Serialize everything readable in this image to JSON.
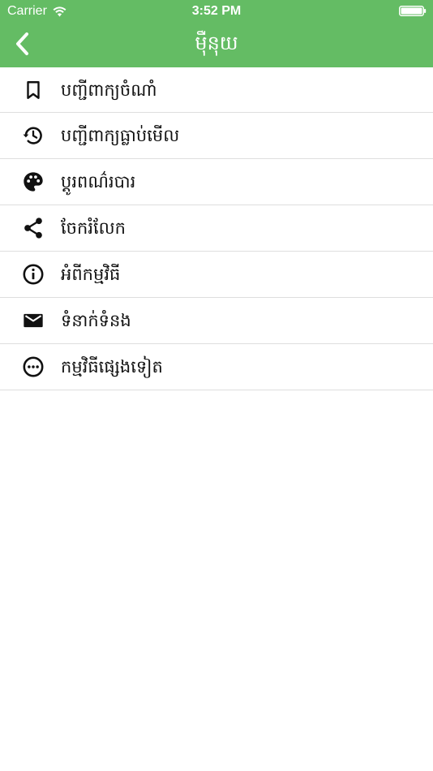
{
  "status_bar": {
    "carrier": "Carrier",
    "time": "3:52 PM"
  },
  "nav_bar": {
    "title": "ម៉ឺនុយ",
    "back_icon": "chevron-left-icon"
  },
  "menu": {
    "items": [
      {
        "label": "បញ្ជីពាក្យចំណាំ",
        "icon": "bookmark-icon"
      },
      {
        "label": "បញ្ជីពាក្យធ្លាប់មើល",
        "icon": "history-icon"
      },
      {
        "label": "ប្តូរពណ៌របារ",
        "icon": "palette-icon"
      },
      {
        "label": "ចែករំលែក",
        "icon": "share-icon"
      },
      {
        "label": "អំពីកម្មវិធី",
        "icon": "info-icon"
      },
      {
        "label": "ទំនាក់ទំនង",
        "icon": "mail-icon"
      },
      {
        "label": "កម្មវិធីផ្សេងទៀត",
        "icon": "more-horizontal-icon"
      }
    ]
  },
  "colors": {
    "header_background": "#64bc64",
    "header_text": "#ffffff",
    "divider": "#dedede",
    "body_background": "#ffffff",
    "text": "#111111"
  }
}
